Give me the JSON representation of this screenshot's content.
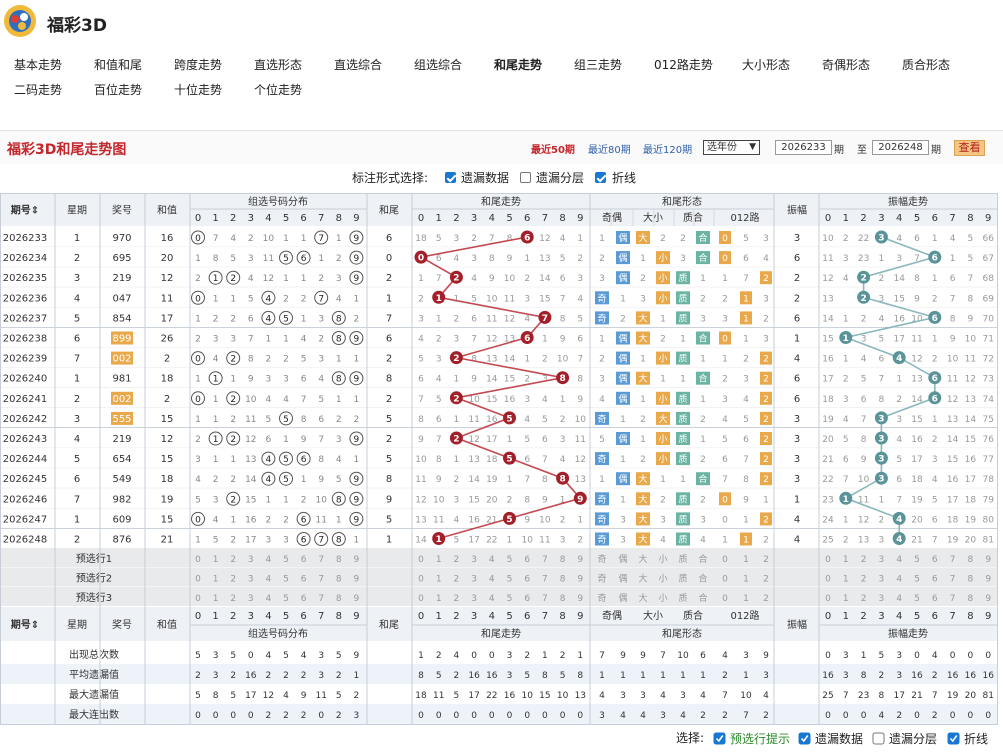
{
  "site_title": "福彩3D",
  "nav": [
    "基本走势",
    "和值和尾",
    "跨度走势",
    "直选形态",
    "直选综合",
    "组选综合",
    "和尾走势",
    "组三走势",
    "012路走势",
    "大小形态",
    "奇偶形态",
    "质合形态",
    "二码走势",
    "百位走势",
    "十位走势",
    "个位走势"
  ],
  "nav_active": 6,
  "panel": {
    "title": "福彩3D和尾走势图",
    "recent50": "最近50期",
    "recent80": "最近80期",
    "recent120": "最近120期",
    "year_select": "选年份",
    "from": "2026233",
    "period1": "期",
    "to_label": "至",
    "to": "2026248",
    "period2": "期",
    "query": "查看"
  },
  "options": {
    "label": "标注形式选择:",
    "o1": "遗漏数据",
    "o2": "遗漏分层",
    "o3": "折线"
  },
  "headers": {
    "issue": "期号",
    "week": "星期",
    "award": "奖号",
    "sum": "和值",
    "group": "组选号码分布",
    "tail": "和尾",
    "tail_trend": "和尾走势",
    "tail_form": "和尾形态",
    "amp": "振幅",
    "amp_trend": "振幅走势",
    "oe": "奇偶",
    "bs": "大小",
    "pc": "质合",
    "r012": "012路"
  },
  "digits": [
    "0",
    "1",
    "2",
    "3",
    "4",
    "5",
    "6",
    "7",
    "8",
    "9"
  ],
  "rows": [
    {
      "issue": "2026233",
      "week": "1",
      "award": "970",
      "sum": "16",
      "tail": "6",
      "amp": "3",
      "g": [
        "⓪",
        "7",
        "4",
        "2",
        "10",
        "1",
        "1",
        "⑦",
        "1",
        "⑨"
      ],
      "t": [
        "18",
        "5",
        "3",
        "2",
        "7",
        "8",
        "⑥",
        "12",
        "4",
        "1"
      ],
      "f": [
        "1",
        "偶",
        "大",
        "2",
        "2",
        "合",
        "0",
        "5",
        "3"
      ],
      "a": [
        "10",
        "2",
        "22",
        "③",
        "4",
        "6",
        "1",
        "4",
        "5",
        "66"
      ]
    },
    {
      "issue": "2026234",
      "week": "2",
      "award": "695",
      "sum": "20",
      "tail": "0",
      "amp": "6",
      "g": [
        "1",
        "8",
        "5",
        "3",
        "11",
        "⑤",
        "⑥",
        "1",
        "2",
        "⑨"
      ],
      "t": [
        "⓪",
        "6",
        "4",
        "3",
        "8",
        "9",
        "1",
        "13",
        "5",
        "2"
      ],
      "f": [
        "2",
        "偶",
        "1",
        "小",
        "3",
        "合",
        "0",
        "6",
        "4"
      ],
      "a": [
        "11",
        "3",
        "23",
        "1",
        "3",
        "7",
        "⑥",
        "1",
        "5",
        "67"
      ]
    },
    {
      "issue": "2026235",
      "week": "3",
      "award": "219",
      "sum": "12",
      "tail": "2",
      "amp": "2",
      "g": [
        "2",
        "①",
        "②",
        "4",
        "12",
        "1",
        "1",
        "2",
        "3",
        "⑨"
      ],
      "t": [
        "1",
        "7",
        "②",
        "4",
        "9",
        "10",
        "2",
        "14",
        "6",
        "3"
      ],
      "f": [
        "3",
        "偶",
        "2",
        "小",
        "质",
        "1",
        "1",
        "7",
        "2"
      ],
      "a": [
        "12",
        "4",
        "②",
        "2",
        "14",
        "8",
        "1",
        "6",
        "7",
        "68"
      ]
    },
    {
      "issue": "2026236",
      "week": "4",
      "award": "047",
      "sum": "11",
      "tail": "1",
      "amp": "2",
      "g": [
        "⓪",
        "1",
        "1",
        "5",
        "④",
        "2",
        "2",
        "⑦",
        "4",
        "1"
      ],
      "t": [
        "2",
        "①",
        "1",
        "5",
        "10",
        "11",
        "3",
        "15",
        "7",
        "4"
      ],
      "f": [
        "奇",
        "1",
        "3",
        "小",
        "质",
        "2",
        "2",
        "1",
        "3"
      ],
      "a": [
        "13",
        "①",
        "1",
        "3",
        "15",
        "9",
        "2",
        "7",
        "8",
        "69"
      ]
    },
    {
      "issue": "2026237",
      "week": "5",
      "award": "854",
      "sum": "17",
      "tail": "7",
      "amp": "6",
      "g": [
        "1",
        "2",
        "2",
        "6",
        "④",
        "⑤",
        "1",
        "3",
        "⑧",
        "2"
      ],
      "t": [
        "3",
        "1",
        "2",
        "6",
        "11",
        "12",
        "4",
        "⑦",
        "8",
        "5"
      ],
      "f": [
        "奇",
        "2",
        "大",
        "1",
        "质",
        "3",
        "3",
        "1",
        "2"
      ],
      "a": [
        "14",
        "1",
        "2",
        "4",
        "16",
        "10",
        "⑥",
        "8",
        "9",
        "70"
      ]
    },
    {
      "issue": "2026238",
      "week": "6",
      "award": "899",
      "sum": "26",
      "tail": "6",
      "amp": "1",
      "g": [
        "2",
        "3",
        "3",
        "7",
        "1",
        "1",
        "4",
        "2",
        "⑧",
        "⑨"
      ],
      "t": [
        "4",
        "2",
        "3",
        "7",
        "12",
        "13",
        "⑥",
        "1",
        "9",
        "6"
      ],
      "f": [
        "1",
        "偶",
        "大",
        "2",
        "1",
        "合",
        "0",
        "1",
        "3"
      ],
      "a": [
        "15",
        "①",
        "3",
        "5",
        "17",
        "11",
        "1",
        "9",
        "10",
        "71"
      ]
    },
    {
      "issue": "2026239",
      "week": "7",
      "award": "002",
      "sum": "2",
      "tail": "2",
      "amp": "4",
      "g": [
        "⓪",
        "4",
        "②",
        "8",
        "2",
        "2",
        "5",
        "3",
        "1",
        "1"
      ],
      "t": [
        "5",
        "3",
        "②",
        "8",
        "13",
        "14",
        "1",
        "2",
        "10",
        "7"
      ],
      "f": [
        "2",
        "偶",
        "1",
        "小",
        "质",
        "1",
        "1",
        "2",
        "2"
      ],
      "a": [
        "16",
        "1",
        "4",
        "6",
        "④",
        "12",
        "2",
        "10",
        "11",
        "72"
      ]
    },
    {
      "issue": "2026240",
      "week": "1",
      "award": "981",
      "sum": "18",
      "tail": "8",
      "amp": "6",
      "g": [
        "1",
        "①",
        "1",
        "9",
        "3",
        "3",
        "6",
        "4",
        "⑧",
        "⑨"
      ],
      "t": [
        "6",
        "4",
        "1",
        "9",
        "14",
        "15",
        "2",
        "3",
        "⑧",
        "8"
      ],
      "f": [
        "3",
        "偶",
        "大",
        "1",
        "1",
        "合",
        "2",
        "3",
        "2"
      ],
      "a": [
        "17",
        "2",
        "5",
        "7",
        "1",
        "13",
        "⑥",
        "11",
        "12",
        "73"
      ]
    },
    {
      "issue": "2026241",
      "week": "2",
      "award": "002",
      "sum": "2",
      "tail": "2",
      "amp": "6",
      "g": [
        "⓪",
        "1",
        "②",
        "10",
        "4",
        "4",
        "7",
        "5",
        "1",
        "1"
      ],
      "t": [
        "7",
        "5",
        "②",
        "10",
        "15",
        "16",
        "3",
        "4",
        "1",
        "9"
      ],
      "f": [
        "4",
        "偶",
        "1",
        "小",
        "质",
        "1",
        "3",
        "4",
        "2"
      ],
      "a": [
        "18",
        "3",
        "6",
        "8",
        "2",
        "14",
        "⑥",
        "12",
        "13",
        "74"
      ]
    },
    {
      "issue": "2026242",
      "week": "3",
      "award": "555",
      "sum": "15",
      "tail": "5",
      "amp": "3",
      "g": [
        "1",
        "1",
        "2",
        "11",
        "5",
        "⑤",
        "8",
        "6",
        "2",
        "2"
      ],
      "t": [
        "8",
        "6",
        "1",
        "11",
        "16",
        "⑤",
        "4",
        "5",
        "2",
        "10"
      ],
      "f": [
        "奇",
        "1",
        "2",
        "大",
        "质",
        "2",
        "4",
        "5",
        "2"
      ],
      "a": [
        "19",
        "4",
        "7",
        "③",
        "3",
        "15",
        "1",
        "13",
        "14",
        "75"
      ]
    },
    {
      "issue": "2026243",
      "week": "4",
      "award": "219",
      "sum": "12",
      "tail": "2",
      "amp": "3",
      "g": [
        "2",
        "①",
        "②",
        "12",
        "6",
        "1",
        "9",
        "7",
        "3",
        "⑨"
      ],
      "t": [
        "9",
        "7",
        "②",
        "12",
        "17",
        "1",
        "5",
        "6",
        "3",
        "11"
      ],
      "f": [
        "5",
        "偶",
        "1",
        "小",
        "质",
        "1",
        "5",
        "6",
        "2"
      ],
      "a": [
        "20",
        "5",
        "8",
        "③",
        "4",
        "16",
        "2",
        "14",
        "15",
        "76"
      ]
    },
    {
      "issue": "2026244",
      "week": "5",
      "award": "654",
      "sum": "15",
      "tail": "5",
      "amp": "3",
      "g": [
        "3",
        "1",
        "1",
        "13",
        "④",
        "⑤",
        "⑥",
        "8",
        "4",
        "1"
      ],
      "t": [
        "10",
        "8",
        "1",
        "13",
        "18",
        "⑤",
        "6",
        "7",
        "4",
        "12"
      ],
      "f": [
        "奇",
        "1",
        "2",
        "小",
        "质",
        "2",
        "6",
        "7",
        "2"
      ],
      "a": [
        "21",
        "6",
        "9",
        "③",
        "5",
        "17",
        "3",
        "15",
        "16",
        "77"
      ]
    },
    {
      "issue": "2026245",
      "week": "6",
      "award": "549",
      "sum": "18",
      "tail": "8",
      "amp": "3",
      "g": [
        "4",
        "2",
        "2",
        "14",
        "④",
        "⑤",
        "1",
        "9",
        "5",
        "⑨"
      ],
      "t": [
        "11",
        "9",
        "2",
        "14",
        "19",
        "1",
        "7",
        "8",
        "⑧",
        "13"
      ],
      "f": [
        "1",
        "偶",
        "大",
        "1",
        "1",
        "合",
        "7",
        "8",
        "2"
      ],
      "a": [
        "22",
        "7",
        "10",
        "③",
        "6",
        "18",
        "4",
        "16",
        "17",
        "78"
      ]
    },
    {
      "issue": "2026246",
      "week": "7",
      "award": "982",
      "sum": "19",
      "tail": "9",
      "amp": "1",
      "g": [
        "5",
        "3",
        "②",
        "15",
        "1",
        "1",
        "2",
        "10",
        "⑧",
        "⑨"
      ],
      "t": [
        "12",
        "10",
        "3",
        "15",
        "20",
        "2",
        "8",
        "9",
        "1",
        "⑨"
      ],
      "f": [
        "奇",
        "1",
        "大",
        "2",
        "质",
        "2",
        "0",
        "9",
        "1"
      ],
      "a": [
        "23",
        "①",
        "11",
        "1",
        "7",
        "19",
        "5",
        "17",
        "18",
        "79"
      ]
    },
    {
      "issue": "2026247",
      "week": "1",
      "award": "609",
      "sum": "15",
      "tail": "5",
      "amp": "4",
      "g": [
        "⓪",
        "4",
        "1",
        "16",
        "2",
        "2",
        "⑥",
        "11",
        "1",
        "⑨"
      ],
      "t": [
        "13",
        "11",
        "4",
        "16",
        "21",
        "⑤",
        "9",
        "10",
        "2",
        "1"
      ],
      "f": [
        "奇",
        "3",
        "大",
        "3",
        "质",
        "3",
        "0",
        "1",
        "2"
      ],
      "a": [
        "24",
        "1",
        "12",
        "2",
        "④",
        "20",
        "6",
        "18",
        "19",
        "80"
      ]
    },
    {
      "issue": "2026248",
      "week": "2",
      "award": "876",
      "sum": "21",
      "tail": "1",
      "amp": "4",
      "g": [
        "1",
        "5",
        "2",
        "17",
        "3",
        "3",
        "⑥",
        "⑦",
        "⑧",
        "1"
      ],
      "t": [
        "14",
        "①",
        "5",
        "17",
        "22",
        "1",
        "10",
        "11",
        "3",
        "2"
      ],
      "f": [
        "奇",
        "3",
        "大",
        "4",
        "质",
        "4",
        "1",
        "1",
        "2"
      ],
      "a": [
        "25",
        "2",
        "13",
        "3",
        "④",
        "21",
        "7",
        "19",
        "20",
        "81"
      ]
    }
  ],
  "pre_rows": [
    "预选行1",
    "预选行2",
    "预选行3"
  ],
  "pre_form": [
    "奇",
    "偶",
    "大",
    "小",
    "质",
    "合",
    "0",
    "1",
    "2"
  ],
  "stats": [
    {
      "label": "出现总次数",
      "g": [
        "5",
        "3",
        "5",
        "0",
        "4",
        "5",
        "4",
        "3",
        "5",
        "9"
      ],
      "t": [
        "1",
        "2",
        "4",
        "0",
        "0",
        "3",
        "2",
        "1",
        "2",
        "1"
      ],
      "f": [
        "7",
        "9",
        "9",
        "7",
        "10",
        "6",
        "4",
        "3",
        "9"
      ],
      "a": [
        "0",
        "3",
        "1",
        "5",
        "3",
        "0",
        "4",
        "0",
        "0",
        "0"
      ]
    },
    {
      "label": "平均遗漏值",
      "g": [
        "2",
        "3",
        "2",
        "16",
        "2",
        "2",
        "2",
        "3",
        "2",
        "1"
      ],
      "t": [
        "8",
        "5",
        "2",
        "16",
        "16",
        "3",
        "5",
        "8",
        "5",
        "8"
      ],
      "f": [
        "1",
        "1",
        "1",
        "1",
        "1",
        "1",
        "2",
        "1",
        "3"
      ],
      "a": [
        "16",
        "3",
        "8",
        "2",
        "3",
        "16",
        "2",
        "16",
        "16",
        "16"
      ]
    },
    {
      "label": "最大遗漏值",
      "g": [
        "5",
        "8",
        "5",
        "17",
        "12",
        "4",
        "9",
        "11",
        "5",
        "2"
      ],
      "t": [
        "18",
        "11",
        "5",
        "17",
        "22",
        "16",
        "10",
        "15",
        "10",
        "13"
      ],
      "f": [
        "4",
        "3",
        "3",
        "4",
        "3",
        "4",
        "7",
        "10",
        "4"
      ],
      "a": [
        "25",
        "7",
        "23",
        "8",
        "17",
        "21",
        "7",
        "19",
        "20",
        "81"
      ]
    },
    {
      "label": "最大连出数",
      "g": [
        "0",
        "0",
        "0",
        "0",
        "2",
        "2",
        "2",
        "0",
        "2",
        "3"
      ],
      "t": [
        "0",
        "0",
        "0",
        "0",
        "0",
        "0",
        "0",
        "0",
        "0",
        "0"
      ],
      "f": [
        "3",
        "4",
        "4",
        "3",
        "4",
        "2",
        "2",
        "7",
        "2"
      ],
      "a": [
        "0",
        "0",
        "0",
        "4",
        "2",
        "0",
        "2",
        "0",
        "0",
        "0"
      ]
    }
  ],
  "footer": {
    "label": "选择:",
    "o1": "预选行提示",
    "o2": "遗漏数据",
    "o3": "遗漏分层",
    "o4": "折线"
  }
}
